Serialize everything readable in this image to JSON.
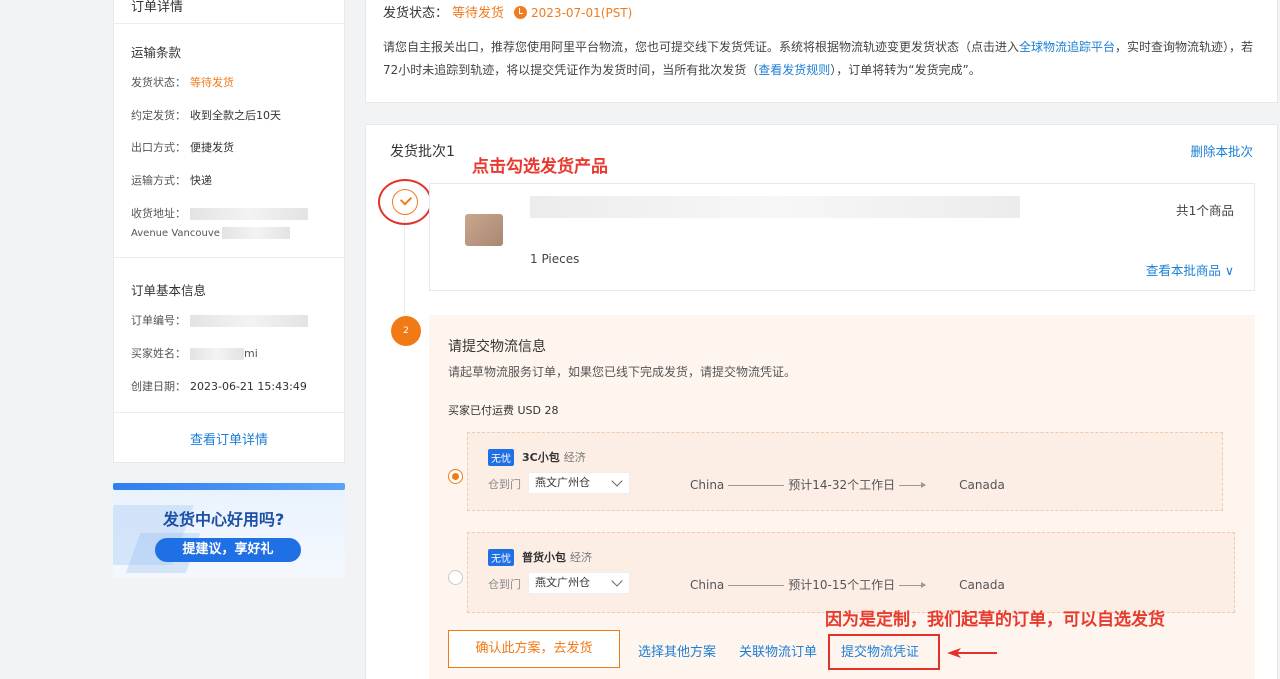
{
  "order_panel": {
    "title": "订单详情",
    "shipping_terms": {
      "heading": "运输条款",
      "rows": [
        {
          "label": "发货状态：",
          "value": "等待发货"
        },
        {
          "label": "约定发货：",
          "value": "收到全款之后10天"
        },
        {
          "label": "出口方式：",
          "value": "便捷发货"
        },
        {
          "label": "运输方式：",
          "value": "快递"
        },
        {
          "label": "收货地址：",
          "value": ""
        }
      ],
      "address_line2": "Avenue Vancouve"
    },
    "basic_info": {
      "heading": "订单基本信息",
      "order_no_label": "订单编号：",
      "buyer_label": "买家姓名：",
      "buyer_suffix": "mi",
      "created_label": "创建日期：",
      "created_value": "2023-06-21 15:43:49"
    },
    "view_details_link": "查看订单详情"
  },
  "banner": {
    "title": "发货中心好用吗?",
    "button": "提建议，享好礼"
  },
  "status": {
    "label": "发货状态：",
    "value": "等待发货",
    "date": "2023-07-01(PST)",
    "desc_part1": "请您自主报关出口，推荐您使用阿里平台物流，您也可提交线下发货凭证。系统将根据物流轨迹变更发货状态（点击进入",
    "desc_link1": "全球物流追踪平台",
    "desc_part2": "，实时查询物流轨迹），若72小时未追踪到轨迹，将以提交凭证作为发货时间，当所有批次发货（",
    "desc_link2": "查看发货规则",
    "desc_part3": "），订单将转为“发货完成”。"
  },
  "batch": {
    "title": "发货批次1",
    "delete_link": "删除本批次",
    "annotation_top": "点击勾选发货产品",
    "step2_number": "2",
    "product": {
      "qty": "1 Pieces",
      "count": "共1个商品",
      "view_link": "查看本批商品"
    },
    "logistics": {
      "title": "请提交物流信息",
      "desc": "请起草物流服务订单，如果您已线下完成发货，请提交物流凭证。",
      "paid": "买家已付运费 USD 28",
      "options": [
        {
          "tag": "无忧",
          "name": "3C小包",
          "type": "经济",
          "warehouse_label": "仓到门",
          "warehouse": "燕文广州仓",
          "from": "China",
          "eta": "预计14-32个工作日",
          "to": "Canada",
          "selected": true
        },
        {
          "tag": "无忧",
          "name": "普货小包",
          "type": "经济",
          "warehouse_label": "仓到门",
          "warehouse": "燕文广州仓",
          "from": "China",
          "eta": "预计10-15个工作日",
          "to": "Canada",
          "selected": false
        }
      ],
      "confirm_button": "确认此方案，去发货",
      "other_plan_link": "选择其他方案",
      "link_order": "关联物流订单",
      "submit_voucher": "提交物流凭证",
      "annotation_bottom": "因为是定制，我们起草的订单，可以自选发货"
    }
  },
  "colors": {
    "accent_orange": "#f27a15",
    "link_blue": "#1b7fd6",
    "annotation_red": "#e3322a"
  }
}
